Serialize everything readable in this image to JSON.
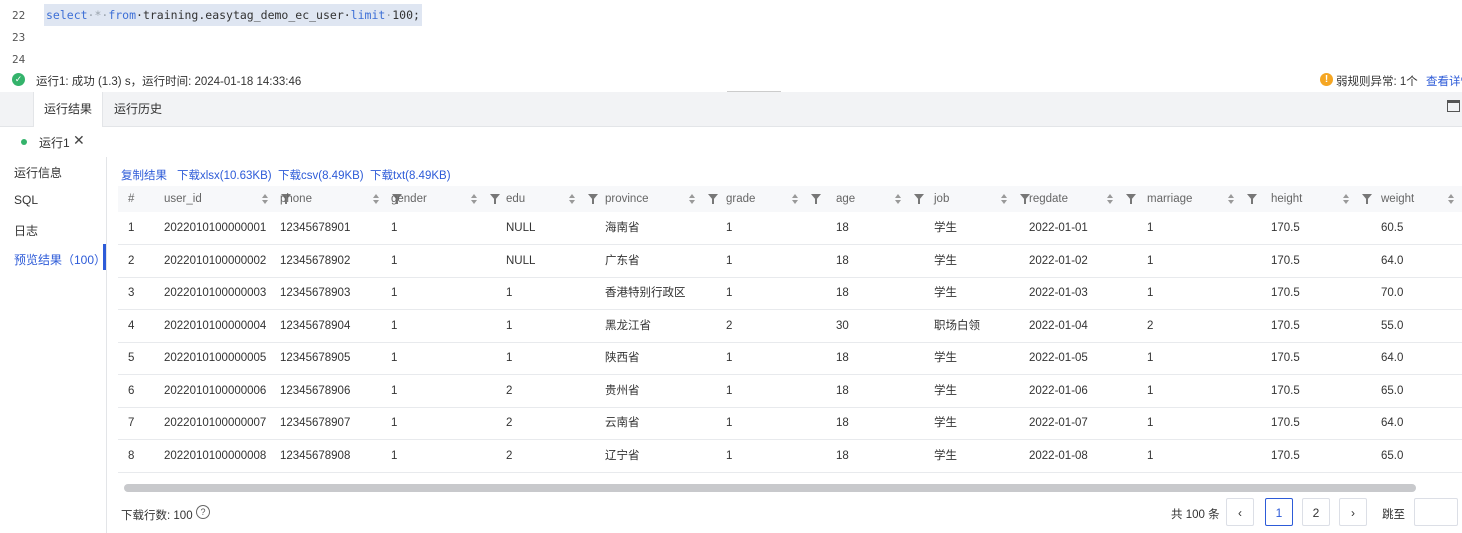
{
  "editor": {
    "lines": [
      {
        "num": "22",
        "tokens": [
          "select",
          "·*·",
          "from",
          "·training.easytag_demo_ec_user·",
          "limit",
          "·",
          "100;"
        ]
      },
      {
        "num": "23"
      },
      {
        "num": "24"
      }
    ]
  },
  "status": {
    "message": "运行1:  成功 (1.3) s，运行时间:  2024-01-18 14:33:46",
    "warning": "弱规则异常:  1个",
    "warning_link": "查看详情"
  },
  "tabs": [
    "运行结果",
    "运行历史"
  ],
  "run_tab": {
    "label": "运行1",
    "close": "✕"
  },
  "left_menu": [
    "运行信息",
    "SQL",
    "日志",
    "预览结果（100）"
  ],
  "downloads": [
    "复制结果",
    "下载xlsx(10.63KB)",
    "下载csv(8.49KB)",
    "下载txt(8.49KB)"
  ],
  "table": {
    "columns": [
      "#",
      "user_id",
      "phone",
      "gender",
      "edu",
      "province",
      "grade",
      "age",
      "job",
      "regdate",
      "marriage",
      "height",
      "weight"
    ],
    "rows": [
      [
        "1",
        "2022010100000001",
        "12345678901",
        "1",
        "NULL",
        "海南省",
        "1",
        "18",
        "学生",
        "2022-01-01",
        "1",
        "170.5",
        "60.5"
      ],
      [
        "2",
        "2022010100000002",
        "12345678902",
        "1",
        "NULL",
        "广东省",
        "1",
        "18",
        "学生",
        "2022-01-02",
        "1",
        "170.5",
        "64.0"
      ],
      [
        "3",
        "2022010100000003",
        "12345678903",
        "1",
        "1",
        "香港特别行政区",
        "1",
        "18",
        "学生",
        "2022-01-03",
        "1",
        "170.5",
        "70.0"
      ],
      [
        "4",
        "2022010100000004",
        "12345678904",
        "1",
        "1",
        "黑龙江省",
        "2",
        "30",
        "职场白领",
        "2022-01-04",
        "2",
        "170.5",
        "55.0"
      ],
      [
        "5",
        "2022010100000005",
        "12345678905",
        "1",
        "1",
        "陕西省",
        "1",
        "18",
        "学生",
        "2022-01-05",
        "1",
        "170.5",
        "64.0"
      ],
      [
        "6",
        "2022010100000006",
        "12345678906",
        "1",
        "2",
        "贵州省",
        "1",
        "18",
        "学生",
        "2022-01-06",
        "1",
        "170.5",
        "65.0"
      ],
      [
        "7",
        "2022010100000007",
        "12345678907",
        "1",
        "2",
        "云南省",
        "1",
        "18",
        "学生",
        "2022-01-07",
        "1",
        "170.5",
        "64.0"
      ],
      [
        "8",
        "2022010100000008",
        "12345678908",
        "1",
        "2",
        "辽宁省",
        "1",
        "18",
        "学生",
        "2022-01-08",
        "1",
        "170.5",
        "65.0"
      ]
    ]
  },
  "footer": {
    "download_rows_label": "下载行数:",
    "download_rows_value": "100",
    "help_glyph": "?",
    "total": "共 100 条",
    "prev": "‹",
    "pages": [
      "1",
      "2"
    ],
    "next": "›",
    "jump_label": "跳至"
  },
  "colors": {
    "accent": "#2d5bd8",
    "success": "#34b36b",
    "warning": "#f5a623"
  }
}
